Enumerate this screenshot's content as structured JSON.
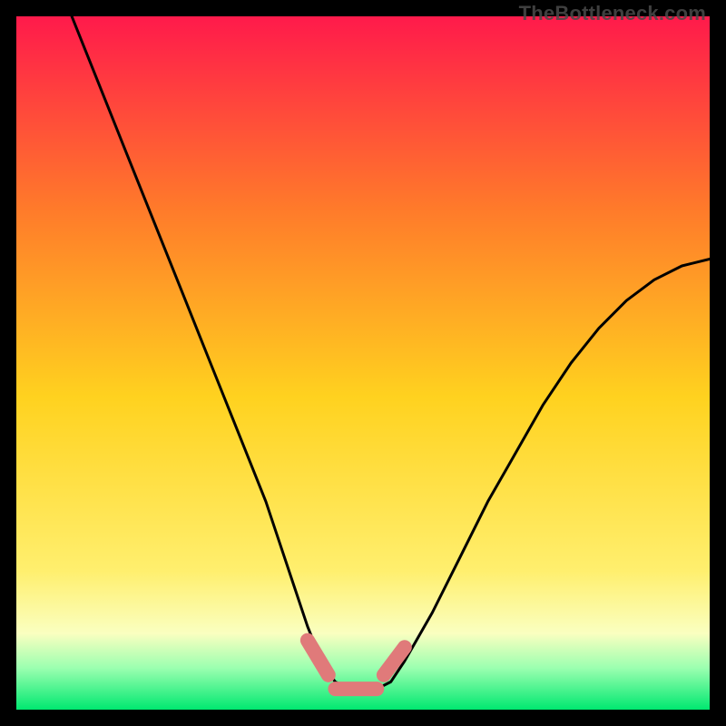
{
  "watermark": "TheBottleneck.com",
  "colors": {
    "gradient_top": "#ff1a4b",
    "gradient_mid_upper": "#ff7b2a",
    "gradient_mid": "#ffd21f",
    "gradient_low": "#faffc0",
    "gradient_green1": "#9bffb0",
    "gradient_green2": "#00e870",
    "curve": "#000000",
    "accent_marker": "#e07a7a"
  },
  "chart_data": {
    "type": "line",
    "title": "",
    "xlabel": "",
    "ylabel": "",
    "xlim": [
      0,
      100
    ],
    "ylim": [
      0,
      100
    ],
    "series": [
      {
        "name": "bottleneck-curve",
        "x": [
          8,
          12,
          16,
          20,
          24,
          28,
          32,
          36,
          40,
          42,
          44,
          46,
          48,
          50,
          52,
          54,
          56,
          60,
          64,
          68,
          72,
          76,
          80,
          84,
          88,
          92,
          96,
          100
        ],
        "y": [
          100,
          90,
          80,
          70,
          60,
          50,
          40,
          30,
          18,
          12,
          7,
          4,
          3,
          3,
          3,
          4,
          7,
          14,
          22,
          30,
          37,
          44,
          50,
          55,
          59,
          62,
          64,
          65
        ]
      }
    ],
    "markers": [
      {
        "name": "left-segment",
        "x": [
          42,
          45
        ],
        "y": [
          10,
          5
        ]
      },
      {
        "name": "flat-segment",
        "x": [
          46,
          52
        ],
        "y": [
          3,
          3
        ]
      },
      {
        "name": "right-segment",
        "x": [
          53,
          56
        ],
        "y": [
          5,
          9
        ]
      }
    ]
  }
}
